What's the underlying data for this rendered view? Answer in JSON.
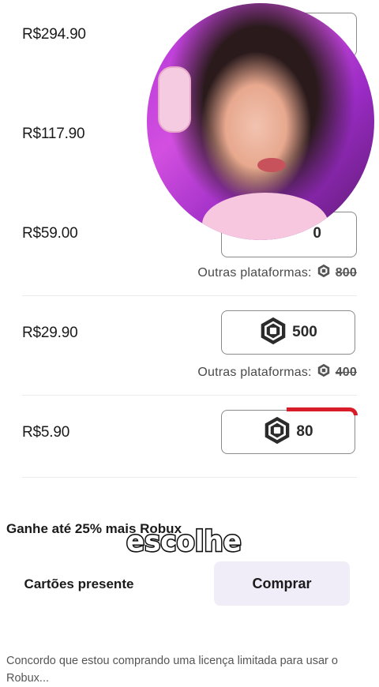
{
  "packages": [
    {
      "price": "R$294.90"
    },
    {
      "price": "R$117.90"
    },
    {
      "price": "R$59.00",
      "robux_partial": "0",
      "other_label": "Outras plataformas:",
      "other_old": "800"
    },
    {
      "price": "R$29.90",
      "robux": "500",
      "other_label": "Outras plataformas:",
      "other_old": "400"
    },
    {
      "price": "R$5.90",
      "robux": "80"
    }
  ],
  "promo_text": "Ganhe até 25% mais Robux",
  "gift_label": "Cartões presente",
  "buy_label": "Comprar",
  "terms_text": "Concordo que estou comprando uma licença limitada para usar o Robux...",
  "caption_text": "escolhe",
  "colors": {
    "accent_red": "#d91c2a",
    "buy_bg": "#f0edf8"
  },
  "icons": {
    "robux": "robux-hexagon-icon"
  }
}
